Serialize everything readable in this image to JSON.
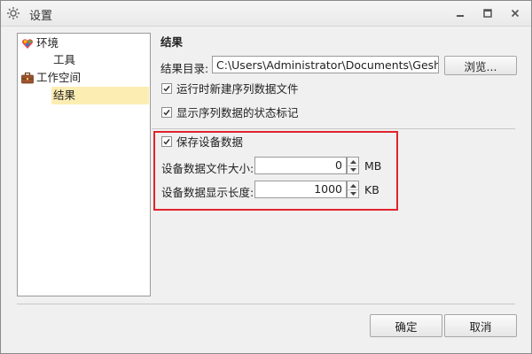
{
  "window": {
    "title": "设置",
    "icon": "gear-icon",
    "controls": [
      "minimize-icon",
      "maximize-icon",
      "close-icon"
    ]
  },
  "tree": {
    "items": [
      {
        "label": "环境",
        "icon": "environment-icon",
        "level": 0
      },
      {
        "label": "工具",
        "level": 1
      },
      {
        "label": "工作空间",
        "icon": "briefcase-icon",
        "level": 0
      },
      {
        "label": "结果",
        "level": 1,
        "selected": true
      }
    ]
  },
  "results": {
    "section_title": "结果",
    "dir_label": "结果目录:",
    "dir_value": "C:\\Users\\Administrator\\Documents\\Geshe\\C",
    "browse_label": "浏览...",
    "run_new_file_label": "运行时新建序列数据文件",
    "run_new_file_checked": true,
    "show_status_label": "显示序列数据的状态标记",
    "show_status_checked": true
  },
  "device": {
    "save_label": "保存设备数据",
    "save_checked": true,
    "file_size_label": "设备数据文件大小:",
    "file_size_value": "0",
    "file_size_unit": "MB",
    "display_len_label": "设备数据显示长度:",
    "display_len_value": "1000",
    "display_len_unit": "KB"
  },
  "buttons": {
    "ok": "确定",
    "cancel": "取消"
  },
  "colors": {
    "highlight_border": "#e0242c",
    "selected_bg": "#fcedb3"
  }
}
